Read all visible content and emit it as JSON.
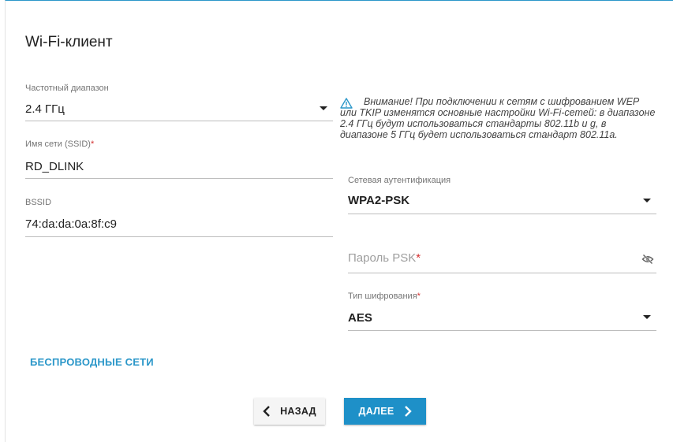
{
  "page": {
    "title": "Wi-Fi-клиент"
  },
  "fields": {
    "band": {
      "label": "Частотный диапазон",
      "value": "2.4 ГГц",
      "icon": "caret-down-icon"
    },
    "ssid": {
      "label": "Имя сети (SSID)",
      "required_mark": "*",
      "value": "RD_DLINK"
    },
    "bssid": {
      "label": "BSSID",
      "value": "74:da:da:0a:8f:c9"
    },
    "auth": {
      "label": "Сетевая аутентификация",
      "value": "WPA2-PSK",
      "icon": "caret-down-icon"
    },
    "psk": {
      "placeholder": "Пароль PSK",
      "required_mark": "*",
      "icon": "eye-off-icon"
    },
    "cipher": {
      "label": "Тип шифрования",
      "required_mark": "*",
      "value": "AES",
      "icon": "caret-down-icon"
    }
  },
  "warning": {
    "icon": "warning-triangle-icon",
    "text": "Внимание! При подключении к сетям с шифрованием WEP или TKIP изменятся основные настройки Wi-Fi-сетей: в диапазоне 2.4 ГГц будут использоваться стандарты 802.11b и g, в диапазоне 5 ГГц будет использоваться стандарт 802.11a."
  },
  "links": {
    "wireless_networks": "БЕСПРОВОДНЫЕ СЕТИ"
  },
  "buttons": {
    "back": "НАЗАД",
    "next": "ДАЛЕЕ"
  },
  "colors": {
    "accent": "#2b97c9",
    "primary_button": "#1e90c8",
    "required": "#d32f2f"
  }
}
